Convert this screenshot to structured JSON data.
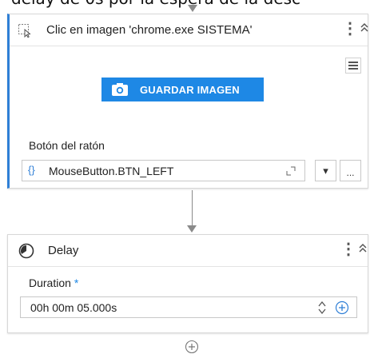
{
  "top_text": "delay de 0s por la espera de la desc",
  "click_activity": {
    "title": "Clic en imagen 'chrome.exe SISTEMA'",
    "save_image_label": "GUARDAR IMAGEN",
    "mouse_button_label": "Botón del ratón",
    "mouse_button_value": "MouseButton.BTN_LEFT",
    "expression_glyph": "{}",
    "more_glyph": "...",
    "dropdown_glyph": "▾"
  },
  "delay_activity": {
    "title": "Delay",
    "duration_label": "Duration",
    "required_mark": "*",
    "duration_value": "00h 00m 05.000s"
  },
  "colors": {
    "accent": "#1e88e5",
    "required": "#1e88e5",
    "selected_border": "#2f7fd6"
  }
}
